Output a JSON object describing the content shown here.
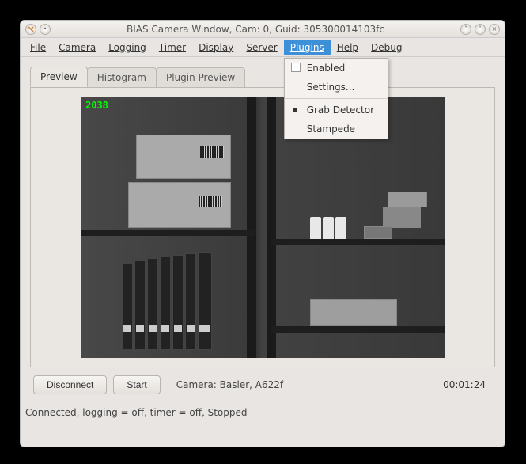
{
  "titlebar": {
    "title": "BIAS Camera Window, Cam: 0, Guid: 305300014103fc"
  },
  "menu": {
    "file": "File",
    "camera": "Camera",
    "logging": "Logging",
    "timer": "Timer",
    "display": "Display",
    "server": "Server",
    "plugins": "Plugins",
    "help": "Help",
    "debug": "Debug"
  },
  "plugins_menu": {
    "enabled": "Enabled",
    "settings": "Settings...",
    "grab_detector": "Grab Detector",
    "stampede": "Stampede"
  },
  "tabs": {
    "preview": "Preview",
    "histogram": "Histogram",
    "plugin_preview": "Plugin Preview"
  },
  "preview": {
    "frame_number": "2038"
  },
  "controls": {
    "disconnect": "Disconnect",
    "start": "Start",
    "camera_label": "Camera:  Basler,  A622f",
    "timer": "00:01:24"
  },
  "status": "Connected, logging = off, timer = off, Stopped"
}
